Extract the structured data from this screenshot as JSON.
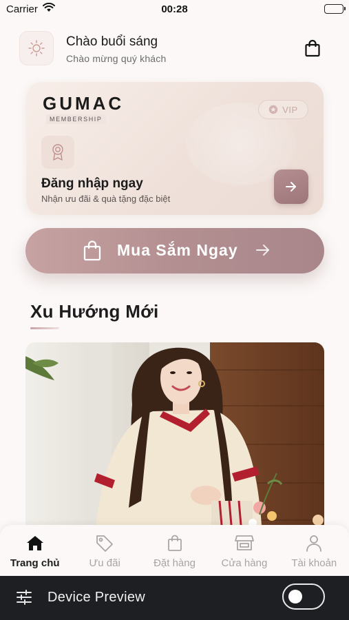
{
  "status_bar": {
    "carrier": "Carrier",
    "time": "00:28"
  },
  "header": {
    "greeting": "Chào buổi sáng",
    "subtitle": "Chào mừng quý khách"
  },
  "membership_card": {
    "brand": "GUMAC",
    "tag": "MEMBERSHIP",
    "vip_label": "VIP",
    "login_title": "Đăng nhập ngay",
    "login_subtitle": "Nhận ưu đãi & quà tặng đặc biệt"
  },
  "shop_button": {
    "label": "Mua Sắm Ngay"
  },
  "trending": {
    "title": "Xu Hướng Mới"
  },
  "tab_bar": {
    "active_index": 0,
    "tabs": [
      {
        "label": "Trang chủ",
        "icon": "home-icon"
      },
      {
        "label": "Ưu đãi",
        "icon": "tag-icon"
      },
      {
        "label": "Đặt hàng",
        "icon": "shopping-bag-icon"
      },
      {
        "label": "Cửa hàng",
        "icon": "store-icon"
      },
      {
        "label": "Tài khoản",
        "icon": "user-icon"
      }
    ]
  },
  "device_preview": {
    "label": "Device Preview",
    "toggle_on": false
  },
  "colors": {
    "accent": "#b38f91",
    "background": "#fbf8f7",
    "device_bar": "#1d1f22"
  }
}
